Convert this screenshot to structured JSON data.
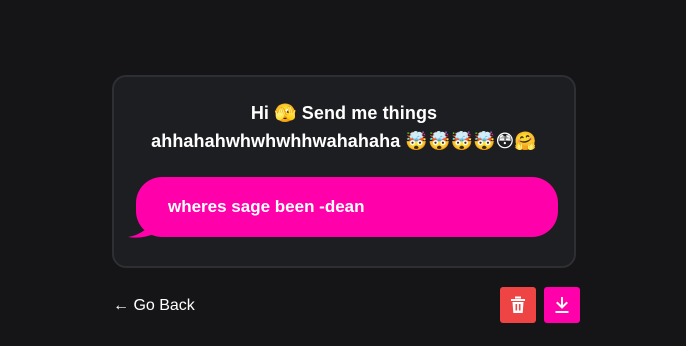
{
  "prompt": {
    "line1": "Hi 🫣 Send me things",
    "line2": "ahhahahwhwhwhhwahahaha 🤯🤯🤯🤯😳🤗"
  },
  "message": {
    "text": "wheres sage been -dean"
  },
  "footer": {
    "back_label": "← Go Back"
  },
  "actions": {
    "delete_icon": "trash-icon",
    "download_icon": "download-icon"
  },
  "colors": {
    "background": "#151518",
    "card": "#1d1e21",
    "bubble": "#ff00aa",
    "delete": "#ef4444",
    "download": "#ff00aa"
  }
}
